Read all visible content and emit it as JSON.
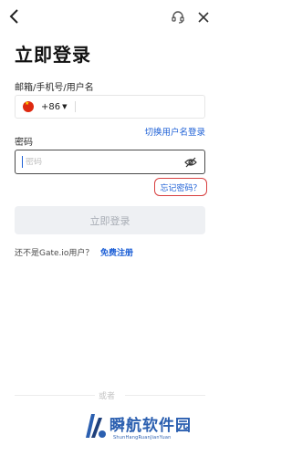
{
  "header": {
    "back_icon": "chevron-left-icon",
    "support_icon": "headset-icon",
    "close_icon": "close-icon"
  },
  "page": {
    "title": "立即登录"
  },
  "account": {
    "label": "邮箱/手机号/用户名",
    "country_code": "+86",
    "flag": "china-flag-icon",
    "value": ""
  },
  "switch_link": "切换用户名登录",
  "password": {
    "label": "密码",
    "placeholder": "密码",
    "toggle_icon": "eye-off-icon"
  },
  "forgot_link": "忘记密码？",
  "login_button": "立即登录",
  "register": {
    "question": "还不是Gate.io用户？",
    "link": "免费注册"
  },
  "divider_text": "或者",
  "watermark": {
    "title": "瞬航软件园",
    "subtitle": "ShunHangRuanJianYuan"
  },
  "colors": {
    "link": "#1c5fd6",
    "highlight_border": "#d84040",
    "button_disabled_bg": "#eef0f3",
    "button_disabled_text": "#a8adb5"
  }
}
